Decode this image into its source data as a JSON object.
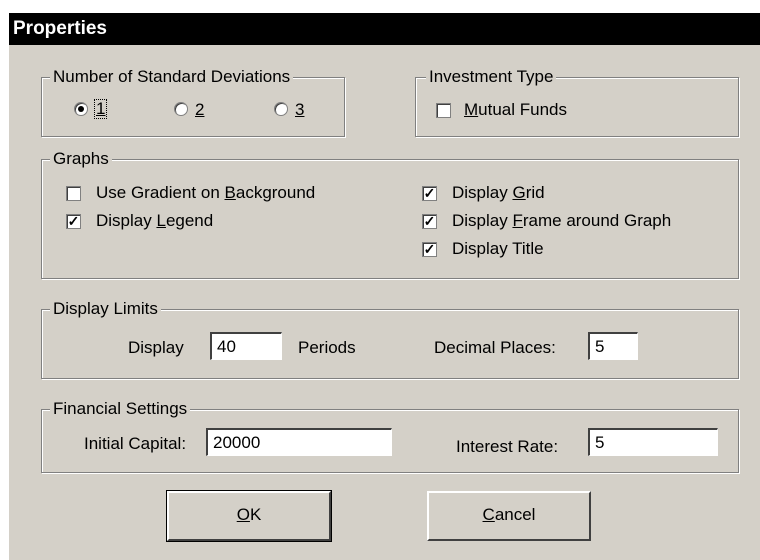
{
  "window": {
    "title": "Properties"
  },
  "std_dev": {
    "label": "Number of Standard Deviations",
    "options": [
      {
        "label": "1",
        "selected": true
      },
      {
        "label": "2",
        "selected": false
      },
      {
        "label": "3",
        "selected": false
      }
    ]
  },
  "investment": {
    "label": "Investment Type",
    "mutual_funds": {
      "pre": "",
      "mnemonic": "M",
      "post": "utual Funds",
      "checked": false
    }
  },
  "graphs": {
    "label": "Graphs",
    "gradient": {
      "pre": "Use Gradient on ",
      "mnemonic": "B",
      "post": "ackground",
      "checked": false
    },
    "legend": {
      "pre": "Display ",
      "mnemonic": "L",
      "post": "egend",
      "checked": true
    },
    "grid": {
      "pre": "Display ",
      "mnemonic": "G",
      "post": "rid",
      "checked": true
    },
    "frame": {
      "pre": "Display ",
      "mnemonic": "F",
      "post": "rame around Graph",
      "checked": true
    },
    "title": {
      "pre": "Display Title",
      "mnemonic": "",
      "post": "",
      "checked": true
    }
  },
  "limits": {
    "label": "Display Limits",
    "display_label": "Display",
    "periods_value": "40",
    "periods_label": "Periods",
    "decimal_label": "Decimal Places:",
    "decimal_value": "5"
  },
  "financial": {
    "label": "Financial Settings",
    "capital_label": "Initial Capital:",
    "capital_value": "20000",
    "interest_label": "Interest Rate:",
    "interest_value": "5"
  },
  "buttons": {
    "ok": {
      "mnemonic": "O",
      "post": "K"
    },
    "cancel": {
      "mnemonic": "C",
      "post": "ancel"
    }
  }
}
